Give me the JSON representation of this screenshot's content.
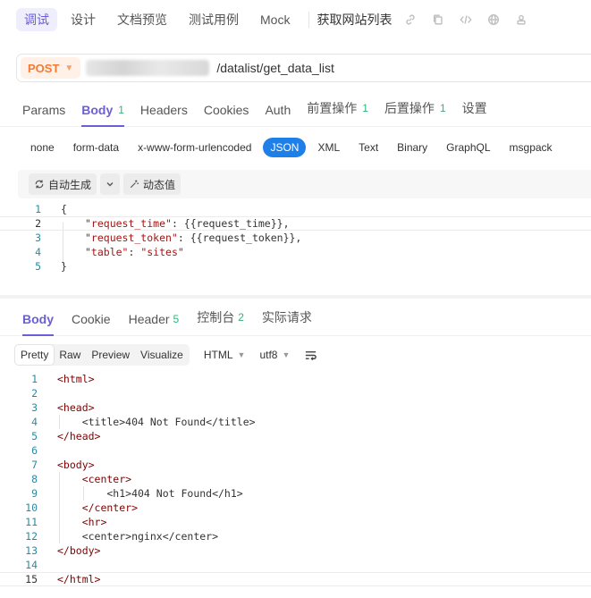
{
  "top_tabs": [
    "调试",
    "设计",
    "文档预览",
    "测试用例",
    "Mock"
  ],
  "top_action": "获取网站列表",
  "top_icons": [
    "link-icon",
    "copy-icon",
    "code-icon",
    "globe-icon",
    "user-icon"
  ],
  "url": {
    "method": "POST",
    "path": "/datalist/get_data_list"
  },
  "request_tabs": [
    {
      "label": "Params",
      "count": ""
    },
    {
      "label": "Body",
      "count": "1"
    },
    {
      "label": "Headers",
      "count": ""
    },
    {
      "label": "Cookies",
      "count": ""
    },
    {
      "label": "Auth",
      "count": ""
    },
    {
      "label": "前置操作",
      "count": "1"
    },
    {
      "label": "后置操作",
      "count": "1"
    },
    {
      "label": "设置",
      "count": ""
    }
  ],
  "body_types": [
    "none",
    "form-data",
    "x-www-form-urlencoded",
    "JSON",
    "XML",
    "Text",
    "Binary",
    "GraphQL",
    "msgpack"
  ],
  "editor_toolbar": {
    "auto_generate": "自动生成",
    "dynamic_value": "动态值"
  },
  "request_body": {
    "line_numbers": [
      "1",
      "2",
      "3",
      "4",
      "5"
    ],
    "open": "{",
    "close": "}",
    "k1": "\"request_time\"",
    "v1": "{{request_time}},",
    "k2": "\"request_token\"",
    "v2": "{{request_token}},",
    "k3": "\"table\"",
    "v3": "\"sites\"",
    "colon": ": "
  },
  "response_tabs": [
    {
      "label": "Body",
      "count": ""
    },
    {
      "label": "Cookie",
      "count": ""
    },
    {
      "label": "Header",
      "count": "5"
    },
    {
      "label": "控制台",
      "count": "2"
    },
    {
      "label": "实际请求",
      "count": ""
    }
  ],
  "view_modes": [
    "Pretty",
    "Raw",
    "Preview",
    "Visualize"
  ],
  "format_select": "HTML",
  "encoding_select": "utf8",
  "response_body": {
    "line_numbers": [
      "1",
      "2",
      "3",
      "4",
      "5",
      "6",
      "7",
      "8",
      "9",
      "10",
      "11",
      "12",
      "13",
      "14",
      "15"
    ],
    "lines": [
      "<html>",
      "",
      "<head>",
      "    <title>404 Not Found</title>",
      "</head>",
      "",
      "<body>",
      "    <center>",
      "        <h1>404 Not Found</h1>",
      "    </center>",
      "    <hr>",
      "    <center>nginx</center>",
      "</body>",
      "",
      "</html>"
    ]
  }
}
